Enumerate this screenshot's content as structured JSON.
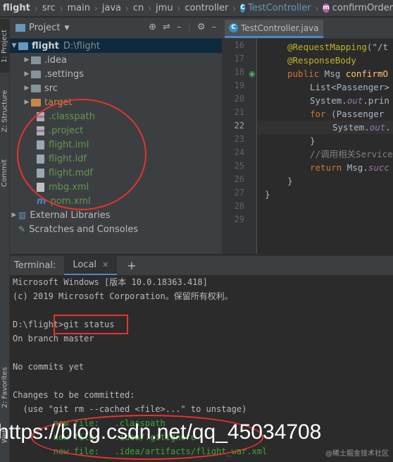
{
  "breadcrumb": [
    "flight",
    "src",
    "main",
    "java",
    "cn",
    "jmu",
    "controller",
    "TestController",
    "confirmOrder"
  ],
  "left_strip_tabs": [
    "1: Project",
    "Z: Structure",
    "Commit",
    "2: Favorites",
    "Web"
  ],
  "project_panel": {
    "title": "Project",
    "root": {
      "name": "flight",
      "path": "D:\\flight"
    },
    "items": [
      {
        "label": ".idea",
        "kind": "folder"
      },
      {
        "label": ".settings",
        "kind": "folder"
      },
      {
        "label": "src",
        "kind": "folder"
      },
      {
        "label": "target",
        "kind": "folder-orange"
      },
      {
        "label": ".classpath",
        "kind": "file"
      },
      {
        "label": ".project",
        "kind": "file"
      },
      {
        "label": "flight.iml",
        "kind": "file"
      },
      {
        "label": "flight.ldf",
        "kind": "file"
      },
      {
        "label": "flight.mdf",
        "kind": "file"
      },
      {
        "label": "mbg.xml",
        "kind": "file"
      },
      {
        "label": "pom.xml",
        "kind": "file"
      }
    ],
    "external_libraries": "External Libraries",
    "scratches": "Scratches and Consoles"
  },
  "editor": {
    "tab": "TestController.java",
    "line_numbers": [
      "16",
      "17",
      "18",
      "19",
      "20",
      "21",
      "22",
      "23",
      "24",
      "25",
      "26",
      "27",
      "28",
      "29"
    ],
    "current_line": "22"
  },
  "terminal": {
    "label": "Terminal:",
    "tab": "Local",
    "lines": [
      "Microsoft Windows [版本 10.0.18363.418]",
      "(c) 2019 Microsoft Corporation。保留所有权利。",
      "",
      "D:\\flight>git status",
      "On branch master",
      "",
      "No commits yet",
      "",
      "Changes to be committed:",
      "  (use \"git rm --cached <file>...\" to unstage)",
      "        new file:   .classpath",
      "        new file:   .idea/.gitignore",
      "        new file:   .idea/artifacts/flight_war.xml"
    ]
  },
  "watermark": "https://blog.csdn.net/qq_45034708",
  "watermark_small": "@稀土掘金技术社区",
  "colors": {
    "bg": "#2b2b2b",
    "panel": "#3c3f41",
    "accent": "#4a88c7",
    "annotation": "#e8322e"
  }
}
